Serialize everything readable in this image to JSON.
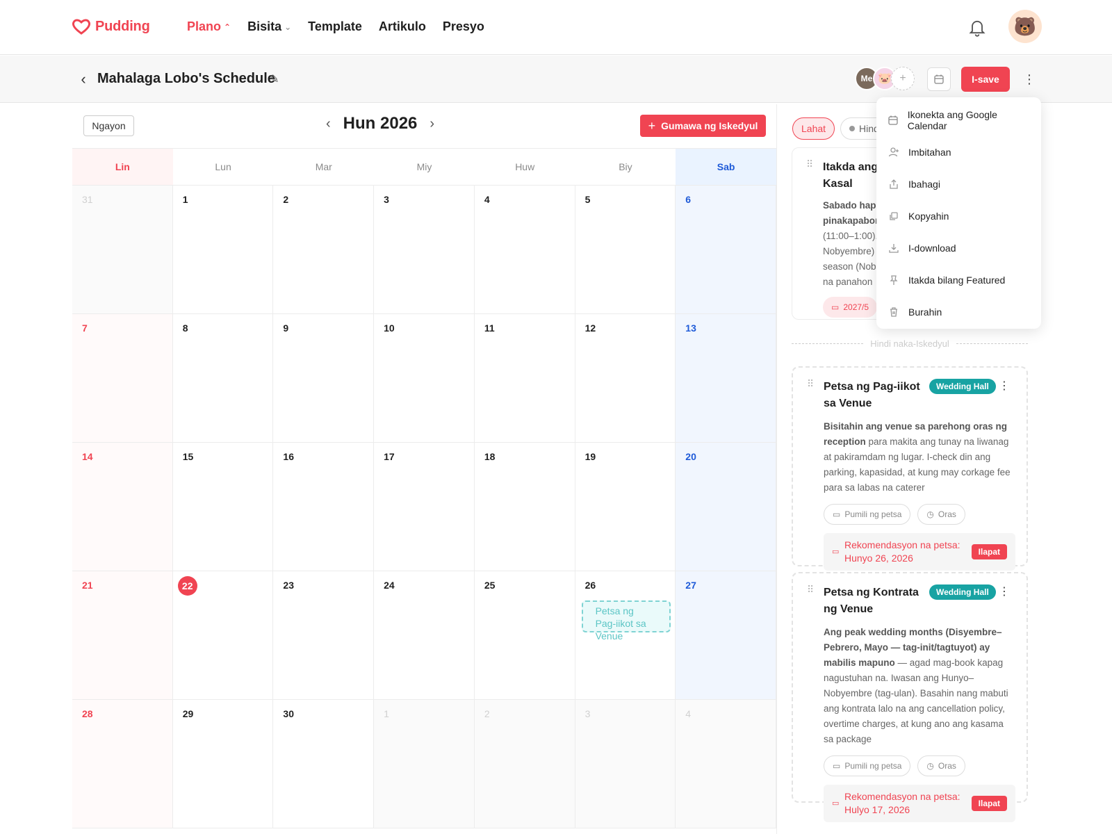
{
  "brand": {
    "name": "Pudding",
    "color": "#f04452"
  },
  "nav": {
    "items": [
      {
        "label": "Plano",
        "active": true,
        "chevron": "up"
      },
      {
        "label": "Bisita",
        "active": false,
        "chevron": "down"
      },
      {
        "label": "Template"
      },
      {
        "label": "Artikulo"
      },
      {
        "label": "Presyo"
      }
    ]
  },
  "header": {
    "title": "Mahalaga Lobo's Schedule",
    "collaborators": {
      "me_label": "Me"
    },
    "save_label": "I-save"
  },
  "calendar": {
    "today_label": "Ngayon",
    "month_title": "Hun 2026",
    "create_label": "Gumawa ng Iskedyul",
    "weekdays": [
      "Lin",
      "Lun",
      "Mar",
      "Miy",
      "Huw",
      "Biy",
      "Sab"
    ],
    "weeks": [
      [
        "31",
        "1",
        "2",
        "3",
        "4",
        "5",
        "6"
      ],
      [
        "7",
        "8",
        "9",
        "10",
        "11",
        "12",
        "13"
      ],
      [
        "14",
        "15",
        "16",
        "17",
        "18",
        "19",
        "20"
      ],
      [
        "21",
        "22",
        "23",
        "24",
        "25",
        "26",
        "27"
      ],
      [
        "28",
        "29",
        "30",
        "1",
        "2",
        "3",
        "4"
      ]
    ],
    "today": "22",
    "event": {
      "label": "Petsa ng Pag-iikot sa Venue",
      "day": "26"
    }
  },
  "panel": {
    "filters": {
      "all": "Lahat",
      "unscheduled": "Hindi"
    },
    "scheduled_card": {
      "title_line1": "Itakda ang",
      "title_line2": "Kasal",
      "desc_lines": [
        "Sabado hap",
        "pinakapabor",
        "(11:00–1:00).",
        "Nobyembre)",
        "season (Nob",
        "na panahon"
      ],
      "date": "2027/5"
    },
    "unscheduled_label": "Hindi naka-Iskedyul",
    "cards": [
      {
        "title": "Petsa ng Pag-iikot sa Venue",
        "badge": "Wedding Hall",
        "desc_bold": "Bisitahin ang venue sa parehong oras ng reception",
        "desc_rest": " para makita ang tunay na liwanag at pakiramdam ng lugar. I-check din ang parking, kapasidad, at kung may corkage fee para sa labas na caterer",
        "date_pill": "Pumili ng petsa",
        "time_pill": "Oras",
        "rec_label": "Rekomendasyon na petsa:",
        "rec_date": "Hunyo 26, 2026",
        "apply": "Ilapat"
      },
      {
        "title": "Petsa ng Kontrata ng Venue",
        "badge": "Wedding Hall",
        "desc_bold": "Ang peak wedding months (Disyembre–Pebrero, Mayo — tag-init/tagtuyot) ay mabilis mapuno",
        "desc_rest": " — agad mag-book kapag nagustuhan na. Iwasan ang Hunyo–Nobyembre (tag-ulan). Basahin nang mabuti ang kontrata lalo na ang cancellation policy, overtime charges, at kung ano ang kasama sa package",
        "date_pill": "Pumili ng petsa",
        "time_pill": "Oras",
        "rec_label": "Rekomendasyon na petsa:",
        "rec_date": "Hulyo 17, 2026",
        "apply": "Ilapat"
      }
    ]
  },
  "menu": {
    "items": [
      {
        "label": "Ikonekta ang Google Calendar",
        "icon": "calendar-icon"
      },
      {
        "label": "Imbitahan",
        "icon": "add-user-icon"
      },
      {
        "label": "Ibahagi",
        "icon": "share-icon"
      },
      {
        "label": "Kopyahin",
        "icon": "copy-icon"
      },
      {
        "label": "I-download",
        "icon": "download-icon"
      },
      {
        "label": "Itakda bilang Featured",
        "icon": "pin-icon"
      },
      {
        "label": "Burahin",
        "icon": "trash-icon"
      }
    ]
  },
  "colors": {
    "accent": "#f04452",
    "teal": "#18a3a3",
    "saturday": "#1e5ad8"
  }
}
